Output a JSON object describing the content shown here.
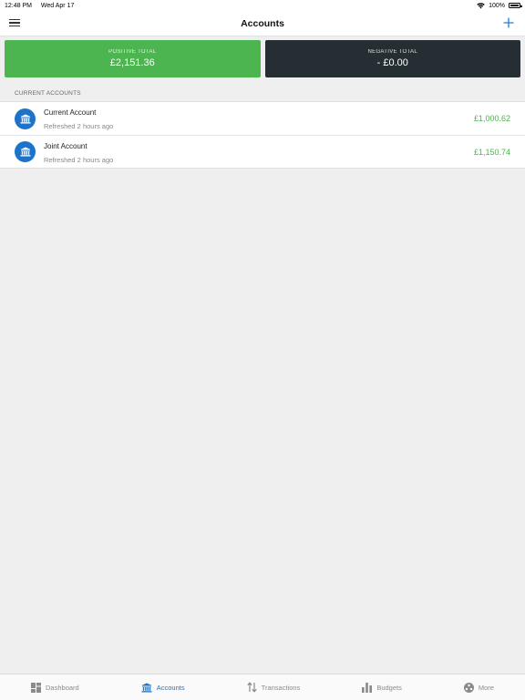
{
  "status": {
    "time": "12:48 PM",
    "date": "Wed Apr 17",
    "battery": "100%"
  },
  "nav": {
    "title": "Accounts"
  },
  "totals": {
    "positive_label": "POSITIVE TOTAL",
    "positive_value": "£2,151.36",
    "negative_label": "NEGATIVE TOTAL",
    "negative_value": "- £0.00",
    "positive_color": "#4cb54f",
    "negative_color": "#252e33"
  },
  "section": {
    "title": "CURRENT ACCOUNTS"
  },
  "accounts": [
    {
      "name": "Current Account",
      "refreshed": "Refreshed 2 hours ago",
      "balance": "£1,000.62"
    },
    {
      "name": "Joint Account",
      "refreshed": "Refreshed 2 hours ago",
      "balance": "£1,150.74"
    }
  ],
  "tabs": [
    {
      "label": "Dashboard",
      "icon": "dashboard-icon",
      "active": false
    },
    {
      "label": "Accounts",
      "icon": "bank-icon",
      "active": true
    },
    {
      "label": "Transactions",
      "icon": "transfer-arrows-icon",
      "active": false
    },
    {
      "label": "Budgets",
      "icon": "bar-chart-icon",
      "active": false
    },
    {
      "label": "More",
      "icon": "more-circle-icon",
      "active": false
    }
  ],
  "colors": {
    "accent": "#1c73c9",
    "balance": "#4cb54f"
  }
}
